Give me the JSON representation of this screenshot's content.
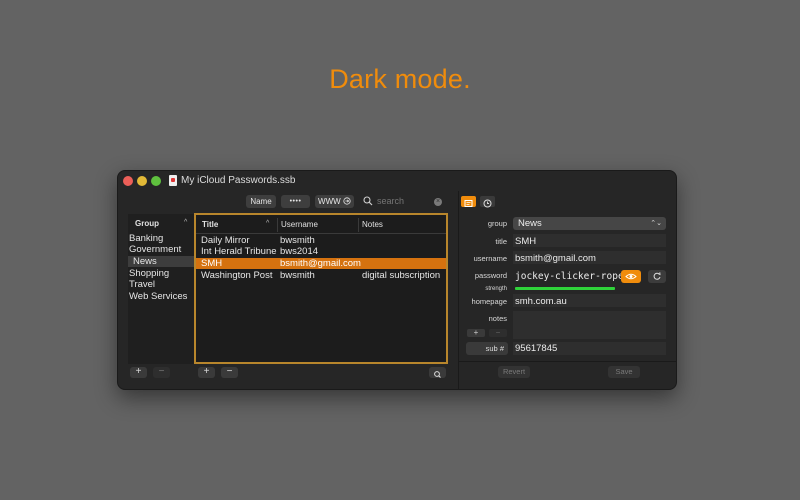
{
  "headline": "Dark mode.",
  "window": {
    "title": "My iCloud Passwords.ssb"
  },
  "toolbar": {
    "name_label": "Name",
    "password_label": "••••",
    "www_label": "WWW",
    "search_placeholder": "search"
  },
  "groups": {
    "header": "Group",
    "items": [
      "Banking",
      "Government",
      "News",
      "Shopping",
      "Travel",
      "Web Services"
    ],
    "selected": "News"
  },
  "table": {
    "columns": [
      "Title",
      "Username",
      "Notes"
    ],
    "rows": [
      {
        "title": "Daily Mirror",
        "username": "bwsmith",
        "notes": ""
      },
      {
        "title": "Int Herald Tribune",
        "username": "bws2014",
        "notes": ""
      },
      {
        "title": "SMH",
        "username": "bsmith@gmail.com",
        "notes": ""
      },
      {
        "title": "Washington Post",
        "username": "bwsmith",
        "notes": "digital subscription"
      }
    ],
    "selected_index": 2
  },
  "detail": {
    "labels": {
      "group": "group",
      "title": "title",
      "username": "username",
      "password": "password",
      "strength": "strength",
      "homepage": "homepage",
      "notes": "notes",
      "sub": "sub #"
    },
    "values": {
      "group": "News",
      "title": "SMH",
      "username": "bsmith@gmail.com",
      "password": "jockey-clicker-rope",
      "homepage": "smh.com.au",
      "notes": "",
      "sub": "95617845"
    },
    "strength_fraction": 1.0,
    "revert_label": "Revert",
    "save_label": "Save"
  },
  "colors": {
    "accent": "#f08c0c",
    "selection": "#d5720f",
    "strength": "#2fd33a"
  }
}
